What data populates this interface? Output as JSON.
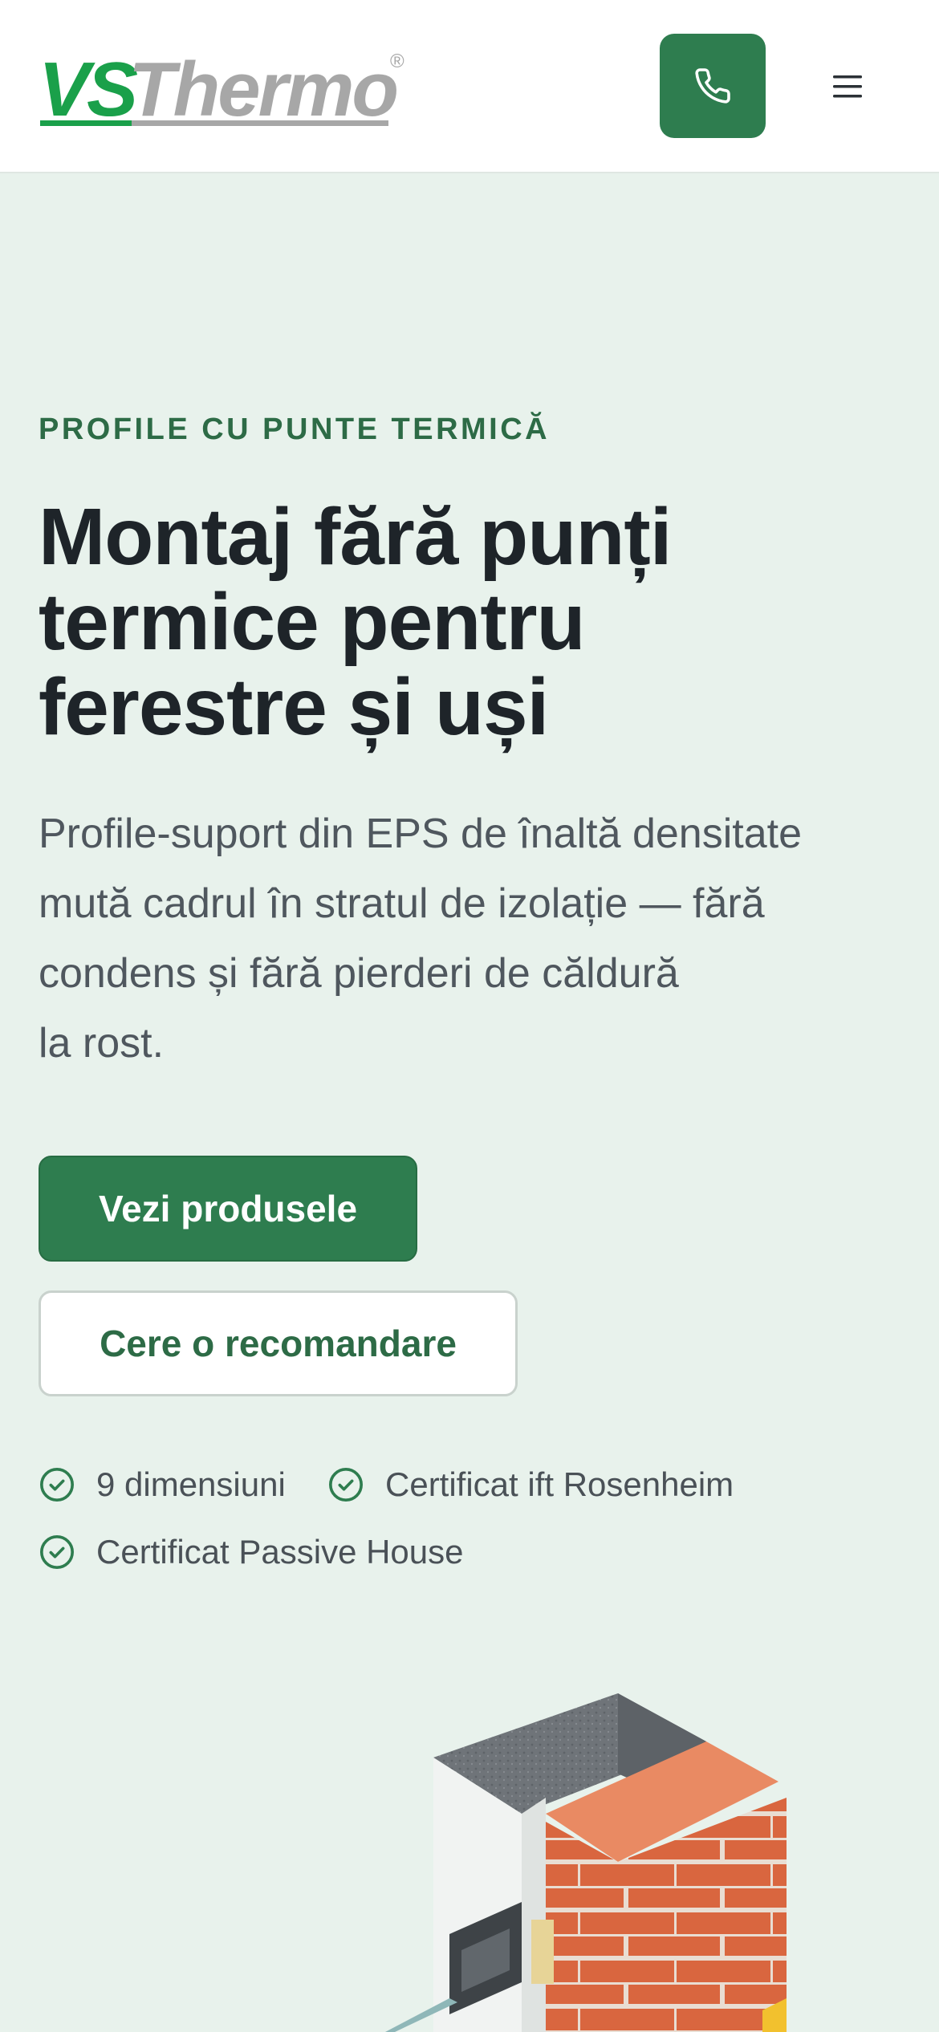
{
  "header": {
    "logo_vs": "VS",
    "logo_thermo": "Thermo",
    "logo_reg": "®",
    "call_icon": "phone-icon",
    "menu_icon": "hamburger-menu-icon"
  },
  "hero": {
    "eyebrow": "PROFILE CU PUNTE TERMICĂ",
    "title_lines": [
      "Montaj fără punți",
      "termice pentru",
      "ferestre și uși"
    ],
    "lead_lines": [
      "Profile-suport din EPS de înaltă densitate",
      "mută cadrul în stratul de izolație — fără",
      "condens și fără pierderi de căldură",
      "la rost."
    ],
    "primary_cta": "Vezi produsele",
    "secondary_cta": "Cere o recomandare",
    "features": [
      {
        "label": "9 dimensiuni",
        "icon": "check-circle-icon"
      },
      {
        "label": "Certificat ift Rosenheim",
        "icon": "check-circle-icon"
      },
      {
        "label": "Certificat Passive House",
        "icon": "check-circle-icon"
      }
    ]
  },
  "colors": {
    "brand_green": "#2e7d4f",
    "logo_green": "#1aa04a",
    "logo_gray": "#a7a7a7",
    "background": "#e8f2ec",
    "text_dark": "#1e2429"
  }
}
